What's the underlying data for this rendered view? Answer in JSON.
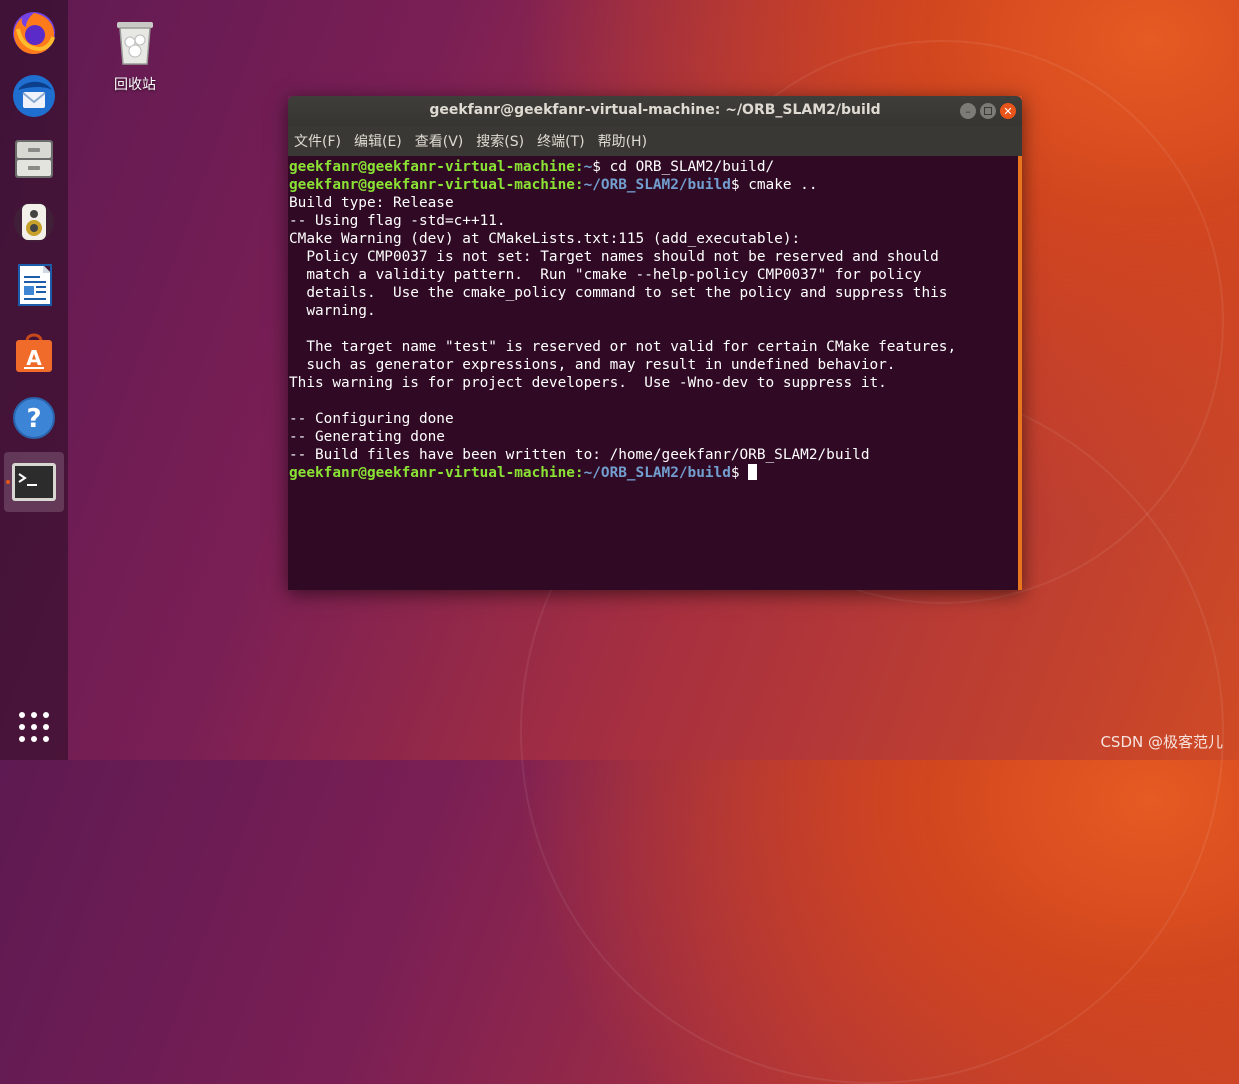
{
  "desktop": {
    "trash_label": "回收站",
    "watermark": "CSDN @极客范儿"
  },
  "dock": {
    "items": [
      {
        "name": "firefox"
      },
      {
        "name": "thunderbird"
      },
      {
        "name": "files"
      },
      {
        "name": "rhythmbox"
      },
      {
        "name": "libreoffice-writer"
      },
      {
        "name": "ubuntu-software"
      },
      {
        "name": "help"
      },
      {
        "name": "terminal",
        "active": true
      }
    ],
    "apps_grid": "show-applications"
  },
  "terminal": {
    "title": "geekfanr@geekfanr-virtual-machine: ~/ORB_SLAM2/build",
    "menu": [
      "文件(F)",
      "编辑(E)",
      "查看(V)",
      "搜索(S)",
      "终端(T)",
      "帮助(H)"
    ],
    "colors": {
      "background": "#300a24",
      "user": "#8ae234",
      "path": "#729fcf",
      "scrollbar": "#e9761f"
    },
    "prompt_user": "geekfanr@geekfanr-virtual-machine:",
    "lines": [
      {
        "path": "~",
        "cmd": "$ cd ORB_SLAM2/build/"
      },
      {
        "path": "~/ORB_SLAM2/build",
        "cmd": "$ cmake .."
      },
      {
        "text": "Build type: Release"
      },
      {
        "text": "-- Using flag -std=c++11."
      },
      {
        "text": "CMake Warning (dev) at CMakeLists.txt:115 (add_executable):"
      },
      {
        "text": "  Policy CMP0037 is not set: Target names should not be reserved and should"
      },
      {
        "text": "  match a validity pattern.  Run \"cmake --help-policy CMP0037\" for policy"
      },
      {
        "text": "  details.  Use the cmake_policy command to set the policy and suppress this"
      },
      {
        "text": "  warning."
      },
      {
        "text": ""
      },
      {
        "text": "  The target name \"test\" is reserved or not valid for certain CMake features,"
      },
      {
        "text": "  such as generator expressions, and may result in undefined behavior."
      },
      {
        "text": "This warning is for project developers.  Use -Wno-dev to suppress it."
      },
      {
        "text": ""
      },
      {
        "text": "-- Configuring done"
      },
      {
        "text": "-- Generating done"
      },
      {
        "text": "-- Build files have been written to: /home/geekfanr/ORB_SLAM2/build"
      },
      {
        "path": "~/ORB_SLAM2/build",
        "cmd": "$ ",
        "cursor": true
      }
    ]
  }
}
